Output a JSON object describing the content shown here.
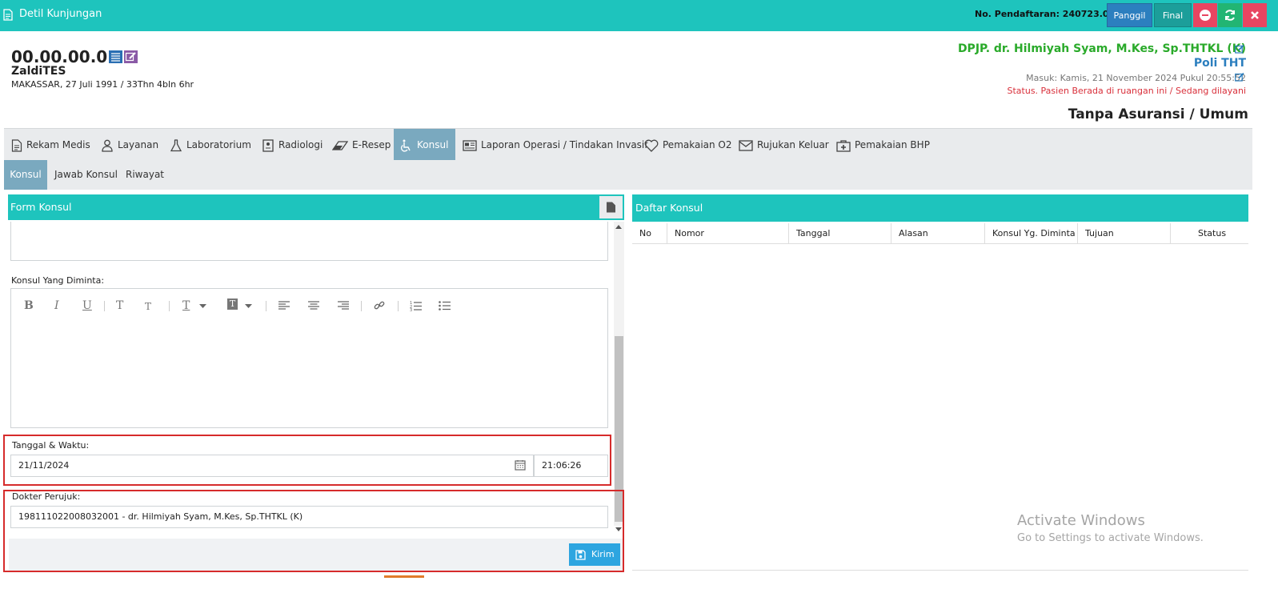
{
  "window": {
    "title": "Detil Kunjungan"
  },
  "header": {
    "registration": "No. Pendaftaran: 240723.0001",
    "panggil_label": "Panggil",
    "final_label": "Final"
  },
  "patient": {
    "id": "00.00.00.01",
    "name": "ZaldiTES",
    "birth": "MAKASSAR, 27 Juli 1991 / 33Thn 4bln 6hr"
  },
  "visit": {
    "dpjp": "DPJP. dr. Hilmiyah Syam, M.Kes, Sp.THTKL (K)",
    "poli": "Poli THT",
    "masuk": "Masuk: Kamis, 21 November 2024 Pukul 20:55:52",
    "status": "Status. Pasien Berada di ruangan ini / Sedang dilayani",
    "insurance": "Tanpa Asuransi / Umum"
  },
  "tabs": [
    {
      "label": "Rekam Medis",
      "icon": "file-icon"
    },
    {
      "label": "Layanan",
      "icon": "user-md-icon"
    },
    {
      "label": "Laboratorium",
      "icon": "flask-icon"
    },
    {
      "label": "Radiologi",
      "icon": "xray-icon"
    },
    {
      "label": "E-Resep",
      "icon": "eraser-icon"
    },
    {
      "label": "Konsul",
      "icon": "wheelchair-icon",
      "active": true
    },
    {
      "label": "Laporan Operasi / Tindakan Invasif",
      "icon": "newspaper-icon"
    },
    {
      "label": "Pemakaian O2",
      "icon": "heart-icon"
    },
    {
      "label": "Rujukan Keluar",
      "icon": "envelope-icon"
    },
    {
      "label": "Pemakaian BHP",
      "icon": "medkit-icon"
    }
  ],
  "subtabs": [
    {
      "label": "Konsul",
      "active": true
    },
    {
      "label": "Jawab Konsul"
    },
    {
      "label": "Riwayat"
    }
  ],
  "form": {
    "title": "Form Konsul",
    "konsul_label": "Konsul Yang Diminta:",
    "toolbar": {
      "bold": "B",
      "italic": "I",
      "underline": "U",
      "sup": "T",
      "sub": "T",
      "color": "T",
      "bg": "T"
    },
    "date_label": "Tanggal & Waktu:",
    "date_value": "21/11/2024",
    "time_value": "21:06:26",
    "dokter_label": "Dokter Perujuk:",
    "dokter_value": "198111022008032001 - dr. Hilmiyah Syam, M.Kes, Sp.THTKL (K)",
    "submit_label": "Kirim"
  },
  "list": {
    "title": "Daftar Konsul",
    "columns": [
      "No",
      "Nomor",
      "Tanggal",
      "Alasan",
      "Konsul Yg. Diminta",
      "Tujuan",
      "Status"
    ]
  },
  "watermark": {
    "line1": "Activate Windows",
    "line2": "Go to Settings to activate Windows."
  },
  "colors": {
    "primary": "#1ec4bd",
    "active_tab": "#7aa9bf",
    "highlight": "#d62b2b",
    "dpjp": "#2aaa2a",
    "poli": "#2c7fbf",
    "status": "#d9303b"
  }
}
